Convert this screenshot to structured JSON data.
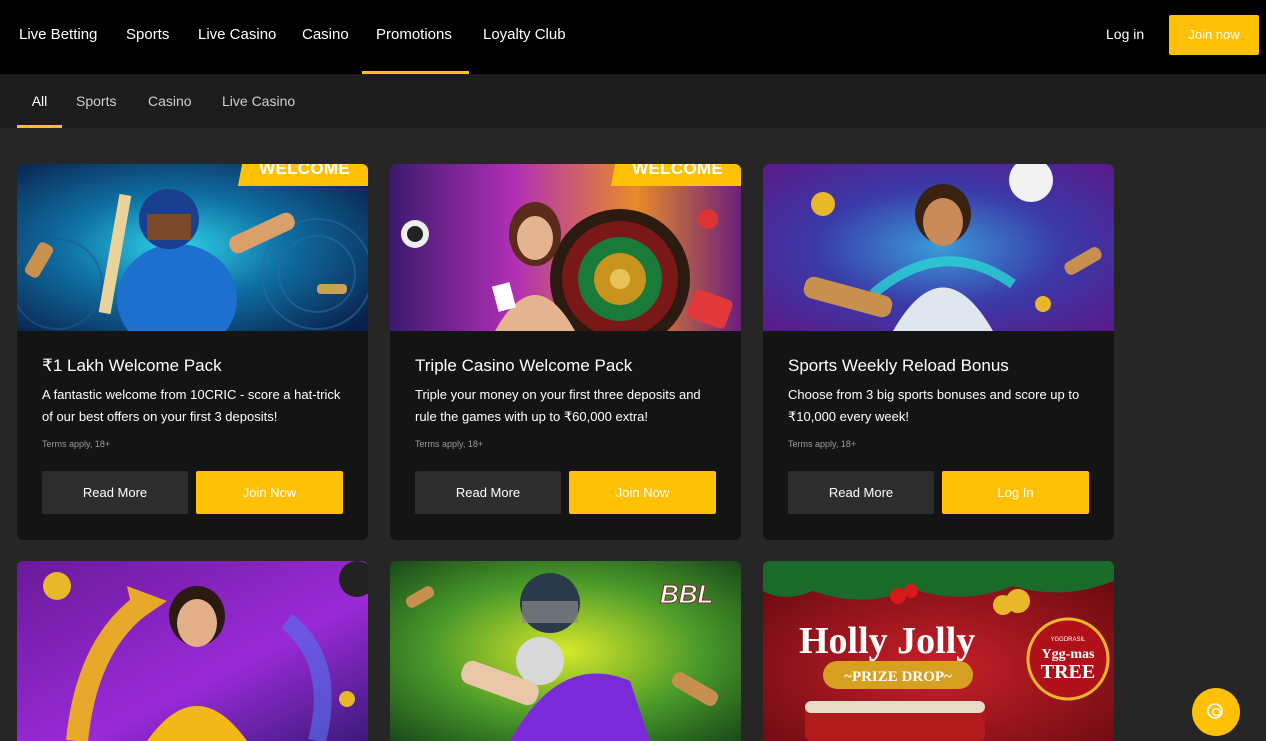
{
  "topnav": {
    "items": [
      {
        "label": "Live Betting"
      },
      {
        "label": "Sports"
      },
      {
        "label": "Live Casino"
      },
      {
        "label": "Casino"
      },
      {
        "label": "Promotions"
      },
      {
        "label": "Loyalty Club"
      }
    ],
    "active_index": 4,
    "login_label": "Log in",
    "join_label": "Join now"
  },
  "subnav": {
    "items": [
      {
        "label": "All"
      },
      {
        "label": "Sports"
      },
      {
        "label": "Casino"
      },
      {
        "label": "Live Casino"
      }
    ],
    "active_index": 0
  },
  "promos": [
    {
      "badge": "WELCOME",
      "title": "₹1 Lakh Welcome Pack",
      "description": "A fantastic welcome from 10CRIC - score a hat-trick of our best offers on your first 3 deposits!",
      "terms": "Terms apply, 18+",
      "read_more_label": "Read More",
      "cta_label": "Join Now"
    },
    {
      "badge": "WELCOME",
      "title": "Triple Casino Welcome Pack",
      "description": "Triple your money on your first three deposits and rule the games with up to ₹60,000 extra!",
      "terms": "Terms apply, 18+",
      "read_more_label": "Read More",
      "cta_label": "Join Now"
    },
    {
      "badge": "",
      "title": "Sports Weekly Reload Bonus",
      "description": "Choose from 3 big sports bonuses and score up to ₹10,000 every week!",
      "terms": "Terms apply, 18+",
      "read_more_label": "Read More",
      "cta_label": "Log In"
    }
  ],
  "second_row": {
    "card2_badge": "BBL",
    "card3_title_line1": "Holly Jolly",
    "card3_subtitle": "~PRIZE DROP~",
    "card3_ornament_brand": "YGGDRASIL",
    "card3_ornament_line1": "Ygg-mas",
    "card3_ornament_line2": "TREE"
  },
  "colors": {
    "accent": "#ffc107",
    "background": "#262626",
    "card": "#141414"
  }
}
